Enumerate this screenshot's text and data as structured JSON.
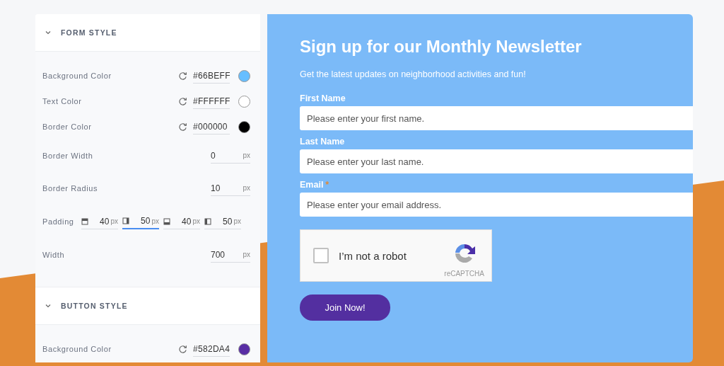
{
  "sections": [
    {
      "title": "FORM STYLE",
      "expanded": true,
      "fields": [
        {
          "kind": "color",
          "label": "Background Color",
          "value": "#66BEFF",
          "color": "#66beff"
        },
        {
          "kind": "color",
          "label": "Text Color",
          "value": "#FFFFFF",
          "color": "#ffffff"
        },
        {
          "kind": "color",
          "label": "Border Color",
          "value": "#000000",
          "color": "#000000"
        },
        {
          "kind": "number",
          "label": "Border Width",
          "value": "0",
          "unit": "px"
        },
        {
          "kind": "number",
          "label": "Border Radius",
          "value": "10",
          "unit": "px"
        },
        {
          "kind": "padding",
          "label": "Padding",
          "sides": [
            {
              "kind": "top",
              "value": "40",
              "unit": "px",
              "focused": false
            },
            {
              "kind": "right",
              "value": "50",
              "unit": "px",
              "focused": true
            },
            {
              "kind": "bottom",
              "value": "40",
              "unit": "px",
              "focused": false
            },
            {
              "kind": "left",
              "value": "50",
              "unit": "px",
              "focused": false
            }
          ]
        },
        {
          "kind": "number",
          "label": "Width",
          "value": "700",
          "unit": "px"
        }
      ]
    },
    {
      "title": "BUTTON STYLE",
      "expanded": true,
      "fields": [
        {
          "kind": "color",
          "label": "Background Color",
          "value": "#582DA4",
          "color": "#582da4"
        }
      ]
    }
  ],
  "preview": {
    "title": "Sign up for our Monthly Newsletter",
    "subtitle": "Get the latest updates on neighborhood activities and fun!",
    "fields": [
      {
        "label": "First Name",
        "placeholder": "Please enter your first name."
      },
      {
        "label": "Last Name",
        "placeholder": "Please enter your last name."
      },
      {
        "label": "Email",
        "required_mark": "*",
        "placeholder": "Please enter your email address."
      }
    ],
    "captcha": {
      "label": "I’m not a robot",
      "checked": false,
      "brand": "reCAPTCHA"
    },
    "button": "Join Now!"
  }
}
